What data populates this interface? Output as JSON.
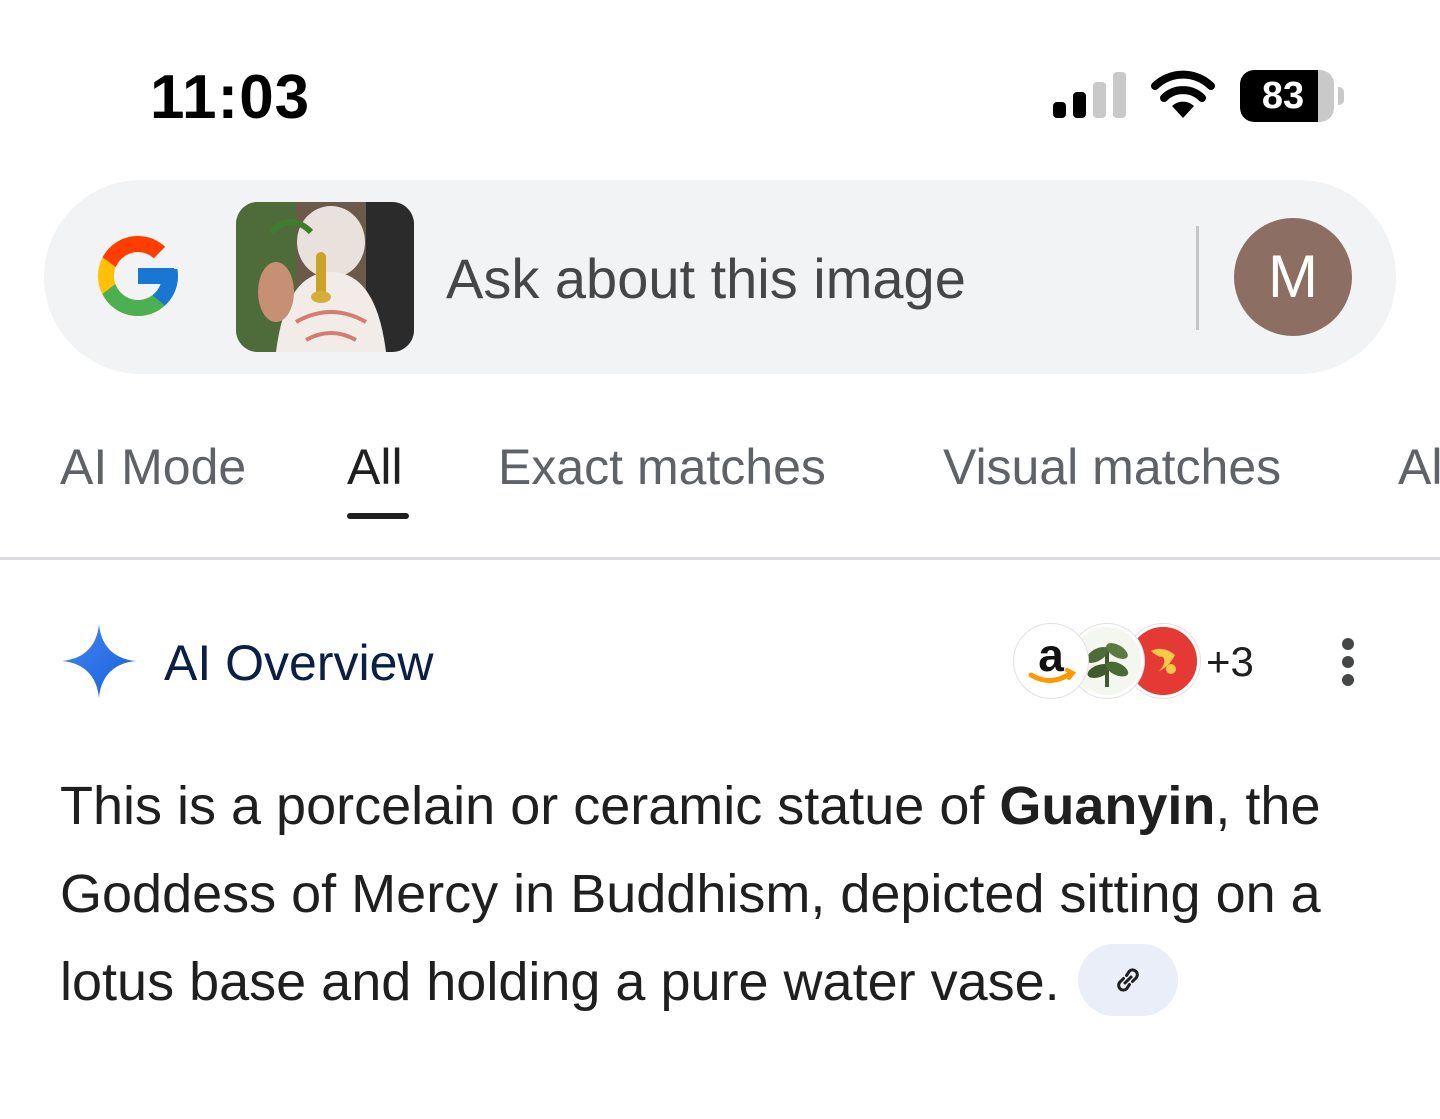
{
  "status_bar": {
    "time": "11:03",
    "battery_percent": "83",
    "battery_level": 0.83,
    "icons": [
      "cellular-signal-icon",
      "wifi-icon",
      "battery-icon"
    ]
  },
  "search": {
    "placeholder": "Ask about this image",
    "logo_icon": "google-g-logo",
    "avatar_initial": "M"
  },
  "tabs": [
    {
      "label": "AI Mode",
      "active": false
    },
    {
      "label": "All",
      "active": true
    },
    {
      "label": "Exact matches",
      "active": false
    },
    {
      "label": "Visual matches",
      "active": false
    },
    {
      "label": "Al",
      "active": false
    }
  ],
  "ai_overview": {
    "title": "AI Overview",
    "source_count": "+3",
    "sources": [
      "amazon-logo",
      "plant-thumbnail",
      "red-logo"
    ],
    "text_before": "This is a porcelain or ceramic statue of ",
    "text_bold": "Guanyin",
    "text_after": ", the Goddess of Mercy in Buddhism, depicted sitting on a lotus base and holding a pure water vase.",
    "link_icon": "link-icon"
  },
  "colors": {
    "accent_blue": "#4285f4",
    "avatar_bg": "#8d6e63",
    "search_bg": "#f1f3f4",
    "ai_title": "#0b1f45"
  }
}
